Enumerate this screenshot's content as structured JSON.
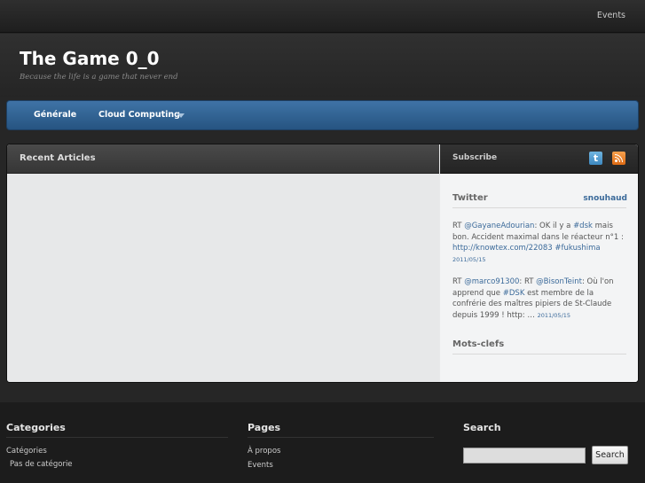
{
  "topbar": {
    "events_link": "Events"
  },
  "header": {
    "title": "The Game 0_0",
    "tagline": "Because the life is a game that never end"
  },
  "nav": {
    "items": [
      {
        "label": "Générale"
      },
      {
        "label": "Cloud Computing",
        "has_dropdown": true
      }
    ]
  },
  "main": {
    "recent_title": "Recent Articles"
  },
  "sidebar": {
    "subscribe_label": "Subscribe",
    "twitter_icon": "twitter-icon",
    "rss_icon": "rss-icon",
    "twitter": {
      "title": "Twitter",
      "user": "snouhaud",
      "tweets": [
        {
          "prefix": "RT ",
          "mention": "@GayaneAdourian",
          "text1": ": OK il y a ",
          "hashtag": "#dsk",
          "text2": " mais bon. Accident maximal dans le réacteur n°1 : ",
          "link": "http://knowtex.com/22083",
          "text3": " ",
          "hashtag2": "#fukushima",
          "date": "2011/05/15"
        },
        {
          "prefix": "RT ",
          "mention": "@marco91300",
          "text1": ": RT ",
          "mention2": "@BisonTeint",
          "text2": ": Où l'on apprend que ",
          "hashtag": "#DSK",
          "text3": " est membre de la confrérie des maîtres pipiers de St-Claude depuis 1999 ! http: … ",
          "date": "2011/05/15"
        }
      ]
    },
    "mots_title": "Mots-clefs"
  },
  "footer": {
    "categories": {
      "title": "Categories",
      "items": [
        "Catégories",
        "Pas de catégorie"
      ]
    },
    "pages": {
      "title": "Pages",
      "items": [
        "À propos",
        "Events"
      ]
    },
    "search": {
      "title": "Search",
      "input_value": "",
      "button_label": "Search"
    }
  },
  "colors": {
    "nav_blue": "#2f639a",
    "link_blue": "#3b6a9a",
    "background": "#262626"
  }
}
